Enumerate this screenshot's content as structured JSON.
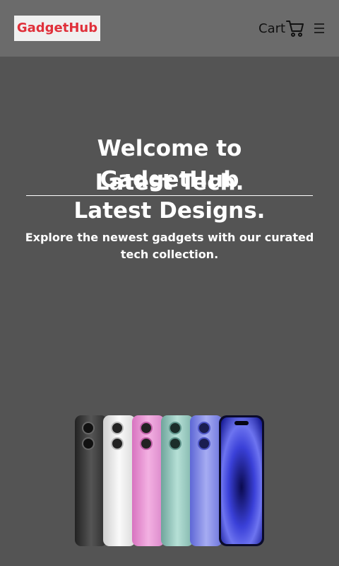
{
  "header": {
    "logo": "GadgetHub",
    "cart_label": "Cart",
    "cart_icon": "shopping-cart-icon",
    "menu_icon": "hamburger-menu-icon"
  },
  "hero": {
    "welcome": "Welcome to GadgetHub",
    "tagline_line1": "Latest Tech.",
    "tagline_line2": "Latest Designs.",
    "subtitle": "Explore the newest gadgets with our curated tech collection.",
    "image_alt": "phones-lineup-image"
  },
  "colors": {
    "logo_text": "#e0303a",
    "header_bg": "#6b6b6b",
    "hero_bg": "#545454"
  }
}
